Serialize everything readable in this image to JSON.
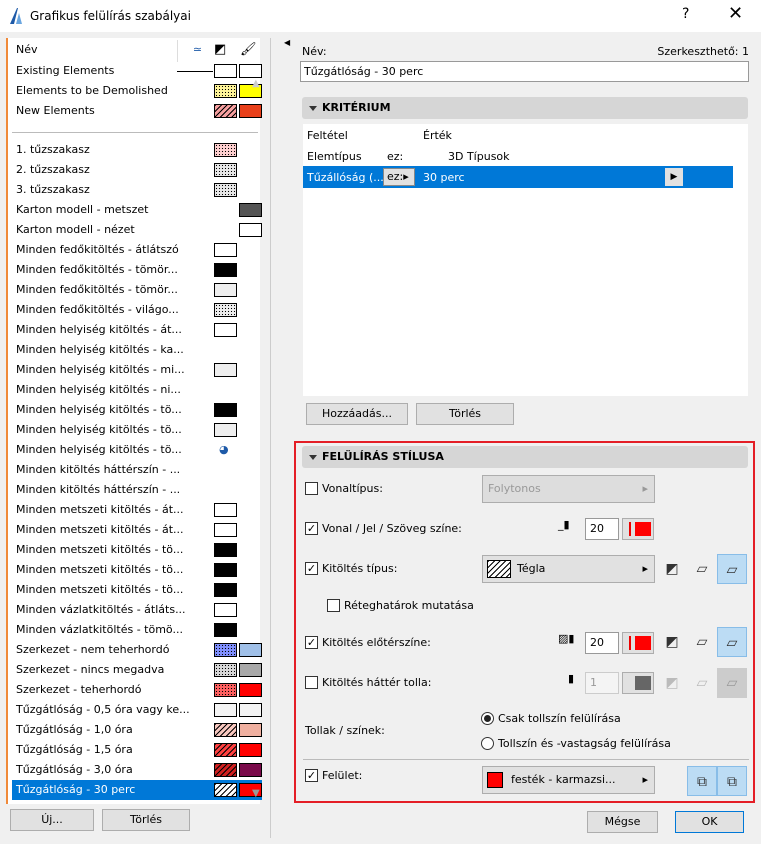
{
  "window": {
    "title": "Grafikus felülírás szabályai",
    "help": "?",
    "close": "✕"
  },
  "list": {
    "header": "Név",
    "top_items": [
      {
        "label": "Existing Elements",
        "fill": "#ffffff",
        "surface": "#ffffff",
        "line": true
      },
      {
        "label": "Elements to be Demolished",
        "fill": "#fff59a",
        "surface": "#ffff00",
        "pattern": "dots"
      },
      {
        "label": "New Elements",
        "fill": "#f7a0a0",
        "surface": "#e8401a",
        "pattern": "hatch"
      }
    ],
    "items": [
      {
        "label": "1. tűzszakasz",
        "fill": "#ffd0d0",
        "pattern": "dots"
      },
      {
        "label": "2. tűzszakasz",
        "fill": "#e8e8e8",
        "pattern": "dots"
      },
      {
        "label": "3. tűzszakasz",
        "fill": "#e8e8e8",
        "pattern": "dots"
      },
      {
        "label": "Karton modell - metszet",
        "surface": "#555555"
      },
      {
        "label": "Karton modell - nézet",
        "surface": "#ffffff"
      },
      {
        "label": "Minden fedőkitöltés - átlátszó",
        "fill": "#ffffff"
      },
      {
        "label": "Minden fedőkitöltés - tömör...",
        "fill": "#000000"
      },
      {
        "label": "Minden fedőkitöltés - tömör...",
        "fill": "#eeeeee"
      },
      {
        "label": "Minden fedőkitöltés - világo...",
        "fill": "#eeeeee",
        "pattern": "dots"
      },
      {
        "label": "Minden helyiség kitöltés - át...",
        "fill": "#ffffff"
      },
      {
        "label": "Minden helyiség kitöltés - ka..."
      },
      {
        "label": "Minden helyiség kitöltés - mi...",
        "fill": "#eeeeee"
      },
      {
        "label": "Minden helyiség kitöltés - ni..."
      },
      {
        "label": "Minden helyiség kitöltés - tö...",
        "fill": "#000000"
      },
      {
        "label": "Minden helyiség kitöltés - tö...",
        "fill": "#eeeeee"
      },
      {
        "label": "Minden helyiség kitöltés - tö...",
        "icon": true
      },
      {
        "label": "Minden kitöltés háttérszín - ..."
      },
      {
        "label": "Minden kitöltés háttérszín - ..."
      },
      {
        "label": "Minden metszeti kitöltés - át...",
        "fill": "#ffffff"
      },
      {
        "label": "Minden metszeti kitöltés - át...",
        "fill": "#ffffff"
      },
      {
        "label": "Minden metszeti kitöltés - tö...",
        "fill": "#000000"
      },
      {
        "label": "Minden metszeti kitöltés - tö...",
        "fill": "#000000"
      },
      {
        "label": "Minden metszeti kitöltés - tö...",
        "fill": "#000000"
      },
      {
        "label": "Minden vázlatkitöltés - átláts...",
        "fill": "#ffffff"
      },
      {
        "label": "Minden vázlatkitöltés - tömö...",
        "fill": "#000000"
      },
      {
        "label": "Szerkezet - nem teherhordó",
        "fill": "#8090ff",
        "surface": "#a0c0e8",
        "pattern": "dots"
      },
      {
        "label": "Szerkezet - nincs megadva",
        "fill": "#d8d8d8",
        "surface": "#a8a8a8",
        "pattern": "dots"
      },
      {
        "label": "Szerkezet - teherhordó",
        "fill": "#ff6060",
        "surface": "#ff0000",
        "pattern": "dots"
      },
      {
        "label": "Tűzgátlóság - 0,5 óra vagy ke...",
        "fill": "#f4f4f4",
        "surface": "#f4f4f4"
      },
      {
        "label": "Tűzgátlóság - 1,0 óra",
        "fill": "#f8c8c0",
        "surface": "#f0b0a0",
        "pattern": "hatch"
      },
      {
        "label": "Tűzgátlóság - 1,5 óra",
        "fill": "#ff4040",
        "surface": "#ff0000",
        "pattern": "hatch"
      },
      {
        "label": "Tűzgátlóság - 3,0 óra",
        "fill": "#d02020",
        "surface": "#7a0a4a",
        "pattern": "hatch"
      },
      {
        "label": "Tűzgátlóság - 30 perc",
        "fill": "#ffffff",
        "surface": "#ff0000",
        "pattern": "hatch",
        "selected": true
      }
    ],
    "new_button": "Új...",
    "delete_button": "Törlés"
  },
  "rule": {
    "name_label": "Név:",
    "editable_label": "Szerkeszthető: 1",
    "name_value": "Tűzgátlóság - 30 perc",
    "criteria": {
      "title": "KRITÉRIUM",
      "col_condition": "Feltétel",
      "col_value": "Érték",
      "rows": [
        {
          "condition": "Elemtípus",
          "op": "ez:",
          "value": "3D Típusok"
        },
        {
          "condition": "Tűzállóság (...",
          "op": "ez:",
          "value": "30 perc"
        }
      ],
      "add_button": "Hozzáadás...",
      "delete_button": "Törlés"
    },
    "style": {
      "title": "FELÜLÍRÁS STÍLUSA",
      "linetype": {
        "label": "Vonaltípus:",
        "checked": false,
        "value": "Folytonos"
      },
      "line_color": {
        "label": "Vonal / Jel / Szöveg színe:",
        "checked": true,
        "pen": "20",
        "color": "#ff0000"
      },
      "fill_type": {
        "label": "Kitöltés típus:",
        "checked": true,
        "value": "Tégla"
      },
      "show_layers": {
        "label": "Réteghatárok mutatása",
        "checked": false
      },
      "fill_fg": {
        "label": "Kitöltés előtérszíne:",
        "checked": true,
        "pen": "20",
        "color": "#ff0000"
      },
      "fill_bg": {
        "label": "Kitöltés háttér tolla:",
        "checked": false,
        "pen": "1"
      },
      "pens": {
        "label": "Tollak / színek:",
        "option1": "Csak tollszín felülírása",
        "option2": "Tollszín és -vastagság felülírása",
        "selected": 1
      },
      "surface": {
        "label": "Felület:",
        "checked": true,
        "value": "festék - karmazsi...",
        "color": "#ff0000"
      }
    }
  },
  "footer": {
    "cancel": "Mégse",
    "ok": "OK"
  }
}
